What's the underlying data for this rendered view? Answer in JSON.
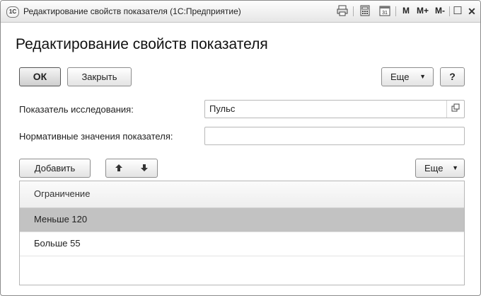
{
  "window": {
    "title": "Редактирование свойств показателя  (1С:Предприятие)",
    "logo_text": "1C",
    "toolbar": {
      "print_icon": "printer-icon",
      "calc_icon": "calculator-icon",
      "calendar_icon": "calendar-icon",
      "memory": [
        "M",
        "M+",
        "M-"
      ],
      "restore_glyph": "☐",
      "close_glyph": "✕"
    }
  },
  "form": {
    "title": "Редактирование свойств показателя",
    "buttons": {
      "ok": "ОК",
      "close": "Закрыть",
      "more": "Еще",
      "help": "?"
    },
    "fields": {
      "indicator_label": "Показатель исследования:",
      "indicator_value": "Пульс",
      "norms_label": "Нормативные значения показателя:",
      "norms_value": ""
    },
    "table_toolbar": {
      "add": "Добавить",
      "up_glyph": "🡅",
      "down_glyph": "🡇",
      "more": "Еще"
    },
    "table": {
      "header": "Ограничение",
      "rows": [
        "Меньше 120",
        "Больше 55"
      ],
      "selected_index": 0
    }
  }
}
